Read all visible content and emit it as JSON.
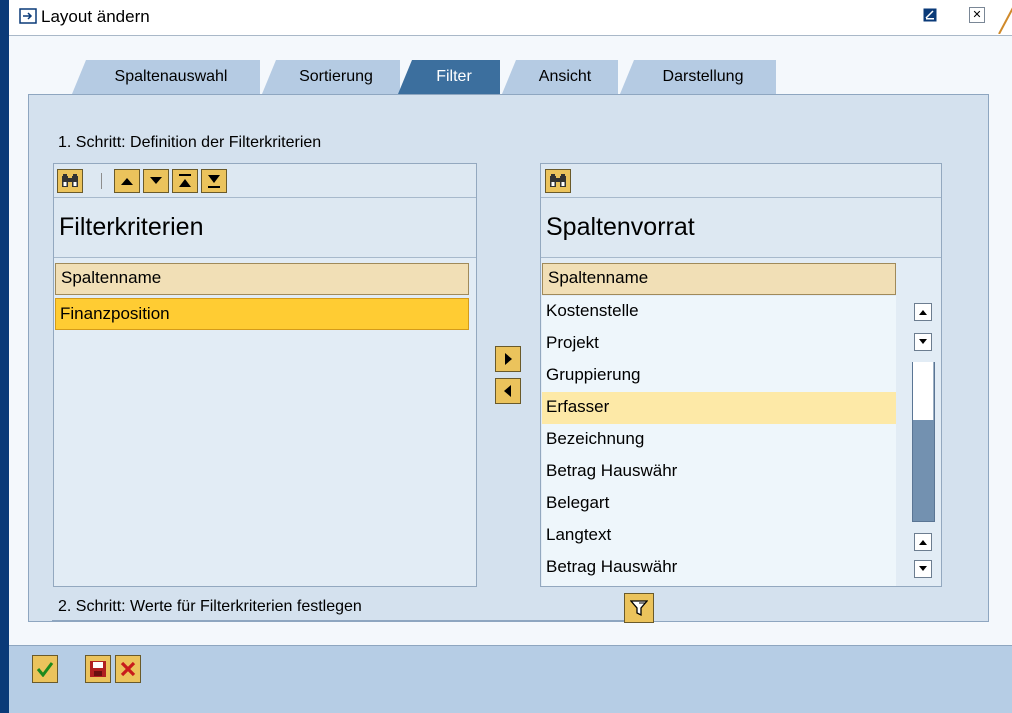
{
  "window": {
    "title": "Layout ändern"
  },
  "tabs": [
    {
      "label": "Spaltenauswahl"
    },
    {
      "label": "Sortierung"
    },
    {
      "label": "Filter"
    },
    {
      "label": "Ansicht"
    },
    {
      "label": "Darstellung"
    }
  ],
  "active_tab": "Filter",
  "step1": "1. Schritt: Definition der Filterkriterien",
  "step2": "2. Schritt: Werte für Filterkriterien festlegen",
  "left_list": {
    "title": "Filterkriterien",
    "column_header": "Spaltenname",
    "rows": [
      "Finanzposition"
    ],
    "selected_row": "Finanzposition"
  },
  "right_list": {
    "title": "Spaltenvorrat",
    "column_header": "Spaltenname",
    "rows": [
      "Kostenstelle",
      "Projekt",
      "Gruppierung",
      "Erfasser",
      "Bezeichnung",
      "Betrag Hauswähr",
      "Belegart",
      "Langtext",
      "Betrag Hauswähr"
    ],
    "selected_row": "Erfasser"
  },
  "icons": {
    "title": "window-layout-icon",
    "find": "binoculars-icon",
    "up": "arrow-up-icon",
    "down": "arrow-down-icon",
    "top": "arrow-top-icon",
    "bottom": "arrow-bottom-icon",
    "move_right": "arrow-right-icon",
    "move_left": "arrow-left-icon",
    "filter": "filter-icon",
    "confirm": "checkmark-icon",
    "save": "save-icon",
    "cancel": "cancel-icon"
  },
  "colors": {
    "accent": "#3c6f9e",
    "selection_orange": "#ffcc33",
    "selection_yellow": "#fde9a7",
    "button": "#ebc35c"
  }
}
